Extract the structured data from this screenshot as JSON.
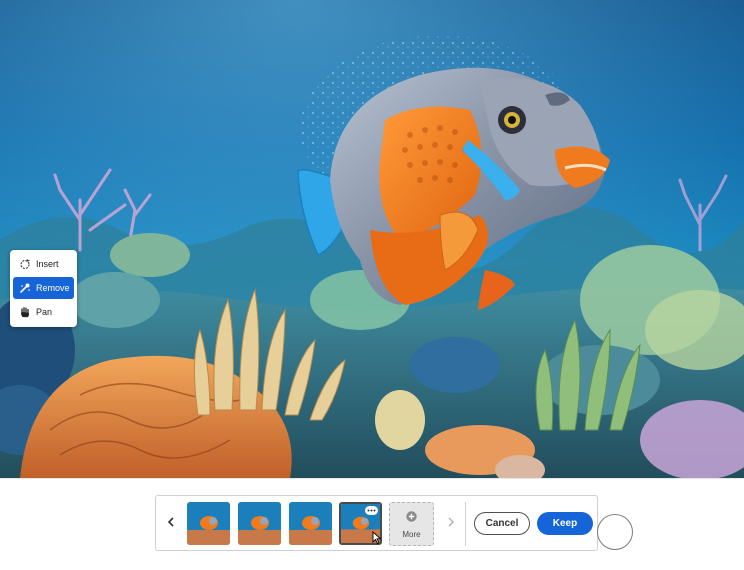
{
  "tool_menu": {
    "items": [
      {
        "label": "Insert",
        "icon": "insert-brush-icon",
        "active": false
      },
      {
        "label": "Remove",
        "icon": "remove-brush-icon",
        "active": true
      },
      {
        "label": "Pan",
        "icon": "hand-icon",
        "active": false
      }
    ]
  },
  "gallery": {
    "thumbnails": 4,
    "selected_index": 3,
    "more_label": "More",
    "prev_icon": "chevron-left-icon",
    "next_icon": "chevron-right-icon"
  },
  "actions": {
    "cancel_label": "Cancel",
    "keep_label": "Keep"
  },
  "colors": {
    "accent": "#1565d8",
    "water": "#0e69a8",
    "fish_orange": "#f07a1e",
    "fish_blue": "#2fa6e8"
  }
}
